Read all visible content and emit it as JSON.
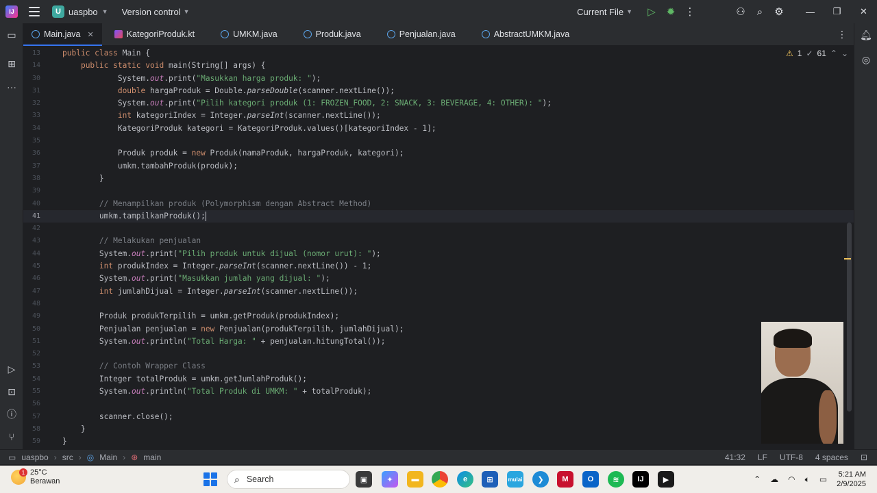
{
  "titlebar": {
    "logo": "IJ",
    "project_badge": "U",
    "project_name": "uaspbo",
    "version_control": "Version control",
    "run_config": "Current File"
  },
  "tabs": [
    {
      "label": "Main.java",
      "active": true
    },
    {
      "label": "KategoriProduk.kt"
    },
    {
      "label": "UMKM.java"
    },
    {
      "label": "Produk.java"
    },
    {
      "label": "Penjualan.java"
    },
    {
      "label": "AbstractUMKM.java"
    }
  ],
  "editor": {
    "warnings_count": "1",
    "weak_warnings_count": "61",
    "lines": [
      {
        "n": "13",
        "t": "public class Main {"
      },
      {
        "n": "14",
        "t": "    public static void main(String[] args) {"
      },
      {
        "n": "30",
        "t": "            System.out.print(\"Masukkan harga produk: \");"
      },
      {
        "n": "31",
        "t": "            double hargaProduk = Double.parseDouble(scanner.nextLine());"
      },
      {
        "n": "32",
        "t": "            System.out.print(\"Pilih kategori produk (1: FROZEN_FOOD, 2: SNACK, 3: BEVERAGE, 4: OTHER): \");"
      },
      {
        "n": "33",
        "t": "            int kategoriIndex = Integer.parseInt(scanner.nextLine());"
      },
      {
        "n": "34",
        "t": "            KategoriProduk kategori = KategoriProduk.values()[kategoriIndex - 1];"
      },
      {
        "n": "35",
        "t": ""
      },
      {
        "n": "36",
        "t": "            Produk produk = new Produk(namaProduk, hargaProduk, kategori);"
      },
      {
        "n": "37",
        "t": "            umkm.tambahProduk(produk);"
      },
      {
        "n": "38",
        "t": "        }"
      },
      {
        "n": "39",
        "t": ""
      },
      {
        "n": "40",
        "t": "        // Menampilkan produk (Polymorphism dengan Abstract Method)"
      },
      {
        "n": "41",
        "t": "        umkm.tampilkanProduk();"
      },
      {
        "n": "42",
        "t": ""
      },
      {
        "n": "43",
        "t": "        // Melakukan penjualan"
      },
      {
        "n": "44",
        "t": "        System.out.print(\"Pilih produk untuk dijual (nomor urut): \");"
      },
      {
        "n": "45",
        "t": "        int produkIndex = Integer.parseInt(scanner.nextLine()) - 1;"
      },
      {
        "n": "46",
        "t": "        System.out.print(\"Masukkan jumlah yang dijual: \");"
      },
      {
        "n": "47",
        "t": "        int jumlahDijual = Integer.parseInt(scanner.nextLine());"
      },
      {
        "n": "48",
        "t": ""
      },
      {
        "n": "49",
        "t": "        Produk produkTerpilih = umkm.getProduk(produkIndex);"
      },
      {
        "n": "50",
        "t": "        Penjualan penjualan = new Penjualan(produkTerpilih, jumlahDijual);"
      },
      {
        "n": "51",
        "t": "        System.out.println(\"Total Harga: \" + penjualan.hitungTotal());"
      },
      {
        "n": "52",
        "t": ""
      },
      {
        "n": "53",
        "t": "        // Contoh Wrapper Class"
      },
      {
        "n": "54",
        "t": "        Integer totalProduk = umkm.getJumlahProduk();"
      },
      {
        "n": "55",
        "t": "        System.out.println(\"Total Produk di UMKM: \" + totalProduk);"
      },
      {
        "n": "56",
        "t": ""
      },
      {
        "n": "57",
        "t": "        scanner.close();"
      },
      {
        "n": "58",
        "t": "    }"
      },
      {
        "n": "59",
        "t": "}"
      }
    ],
    "current_line": "41"
  },
  "statusbar": {
    "breadcrumb": [
      "uaspbo",
      "src",
      "Main",
      "main"
    ],
    "position": "41:32",
    "line_sep": "LF",
    "encoding": "UTF-8",
    "indent": "4 spaces"
  },
  "taskbar": {
    "weather_temp": "25°C",
    "weather_desc": "Berawan",
    "weather_badge": "1",
    "search_placeholder": "Search",
    "time": "5:21 AM",
    "date": "2/9/2025"
  }
}
